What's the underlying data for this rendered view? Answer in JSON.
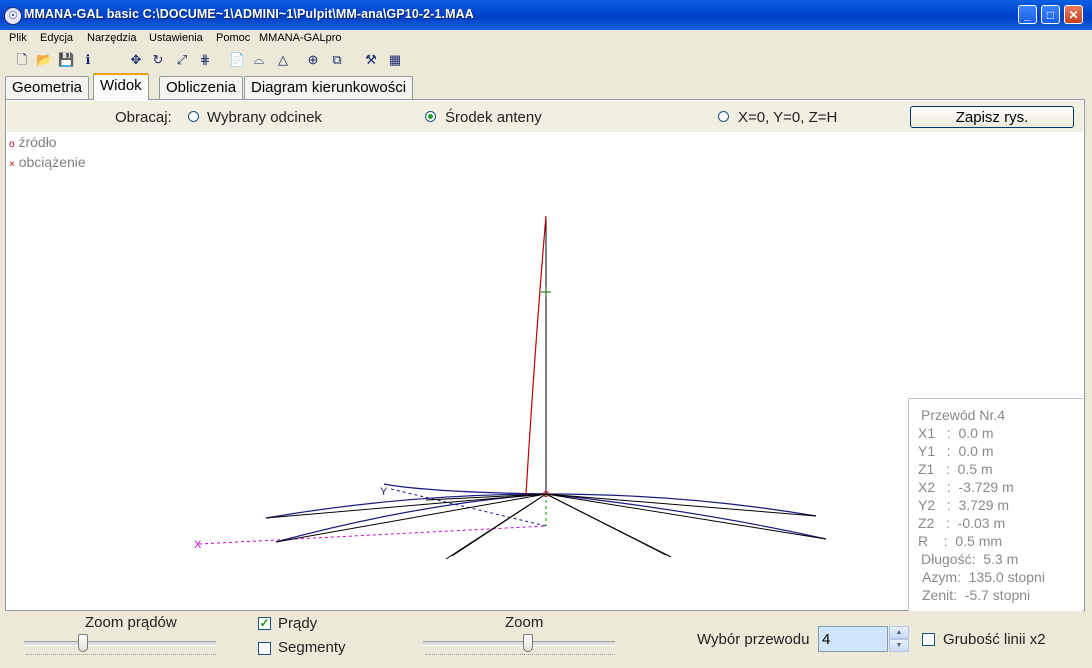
{
  "window": {
    "title": "MMANA-GAL basic C:\\DOCUME~1\\ADMINI~1\\Pulpit\\MM-ana\\GP10-2-1.MAA",
    "icon": "app-icon"
  },
  "menu": [
    "Plik",
    "Edycja",
    "Narzędzia",
    "Ustawienia",
    "Pomoc",
    "MMANA-GALpro"
  ],
  "tabs": [
    "Geometria",
    "Widok",
    "Obliczenia",
    "Diagram kierunkowości"
  ],
  "active_tab": "Widok",
  "rotate": {
    "label": "Obracaj:",
    "options": [
      "Wybrany odcinek",
      "Środek anteny",
      "X=0, Y=0, Z=H"
    ],
    "selected": "Środek anteny"
  },
  "save_button": "Zapisz rys.",
  "legend": {
    "source": "źródło",
    "load": "obciążenie",
    "source_color": "#c00000",
    "load_color": "#c00000"
  },
  "axes": {
    "x": "X",
    "y": "Y"
  },
  "wire_info": {
    "title": "Przewód Nr.4",
    "x1": "X1   :  0.0 m",
    "y1": "Y1   :  0.0 m",
    "z1": "Z1   :  0.5 m",
    "x2": "X2   :  -3.729 m",
    "y2": "Y2   :  3.729 m",
    "z2": "Z2   :  -0.03 m",
    "r": "R    :  0.5 mm",
    "length": "Długość:  5.3 m",
    "azimuth": "Azym:  135.0 stopni",
    "zenith": "Zenit:  -5.7 stopni"
  },
  "bottom": {
    "current_zoom_label": "Zoom prądów",
    "currents_label": "Prądy",
    "currents_checked": true,
    "segments_label": "Segmenty",
    "segments_checked": false,
    "zoom_label": "Zoom",
    "wire_select_label": "Wybór przewodu",
    "wire_select_value": "4",
    "thick_lines_label": "Grubość linii x2",
    "thick_lines_checked": false
  },
  "colors": {
    "wire": "#000000",
    "current": "#c00000",
    "ground": "#1a1a80",
    "axis_x": "#d000d0",
    "axis_y": "#1a1a80"
  }
}
